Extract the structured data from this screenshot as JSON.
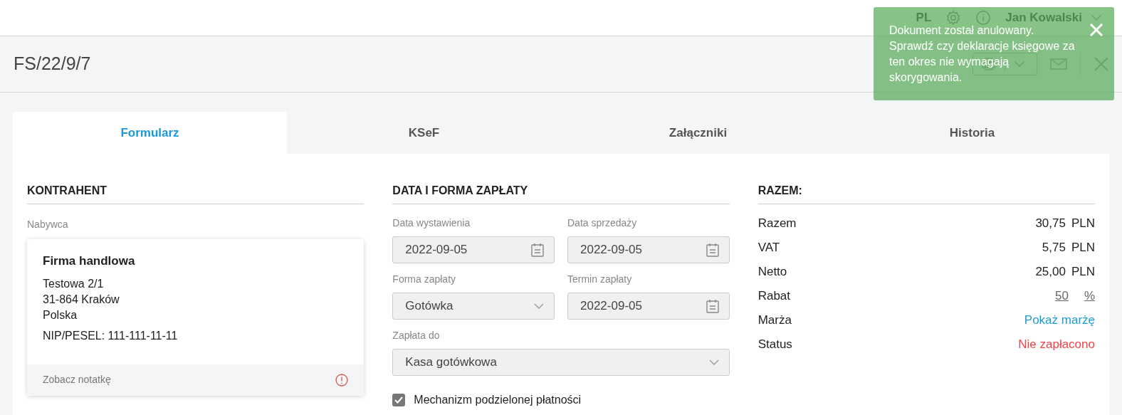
{
  "header": {
    "language": "PL",
    "user": "Jan Kowalski"
  },
  "document": {
    "title": "FS/22/9/7"
  },
  "toast": {
    "message": "Dokument został anulowany. Sprawdź czy deklaracje księgowe za ten okres nie wymagają skorygowania."
  },
  "tabs": [
    {
      "label": "Formularz",
      "selected": true
    },
    {
      "label": "KSeF",
      "selected": false
    },
    {
      "label": "Załączniki",
      "selected": false
    },
    {
      "label": "Historia",
      "selected": false
    }
  ],
  "contractor": {
    "heading": "KONTRAHENT",
    "label": "Nabywca",
    "name": "Firma handlowa",
    "address": [
      "Testowa 2/1",
      "31-864 Kraków",
      "Polska"
    ],
    "tax_id": "NIP/PESEL: 111-111-11-11",
    "note_link": "Zobacz notatkę"
  },
  "payment": {
    "heading": "DATA I FORMA ZAPŁATY",
    "rows": [
      [
        {
          "label": "Data wystawienia",
          "value": "2022-09-05",
          "kind": "date",
          "disabled": true
        },
        {
          "label": "Data sprzedaży",
          "value": "2022-09-05",
          "kind": "date",
          "disabled": true
        }
      ],
      [
        {
          "label": "Forma zapłaty",
          "value": "Gotówka",
          "kind": "select",
          "disabled": true
        },
        {
          "label": "Termin zapłaty",
          "value": "2022-09-05",
          "kind": "date",
          "disabled": true
        }
      ],
      [
        {
          "label": "Zapłata do",
          "value": "Kasa gotówkowa",
          "kind": "select",
          "disabled": true
        }
      ]
    ],
    "split_payment": {
      "label": "Mechanizm podzielonej płatności",
      "checked": true
    }
  },
  "totals": {
    "heading": "RAZEM:",
    "rows": [
      {
        "label": "Razem",
        "kind": "amount",
        "value": "30,75",
        "unit": "PLN"
      },
      {
        "label": "VAT",
        "kind": "amount",
        "value": "5,75",
        "unit": "PLN"
      },
      {
        "label": "Netto",
        "kind": "amount",
        "value": "25,00",
        "unit": "PLN"
      },
      {
        "label": "Rabat",
        "kind": "discount",
        "value": "50",
        "unit": "%"
      },
      {
        "label": "Marża",
        "kind": "link",
        "value": "Pokaż marżę"
      },
      {
        "label": "Status",
        "kind": "status",
        "value": "Nie zapłacono"
      }
    ]
  }
}
